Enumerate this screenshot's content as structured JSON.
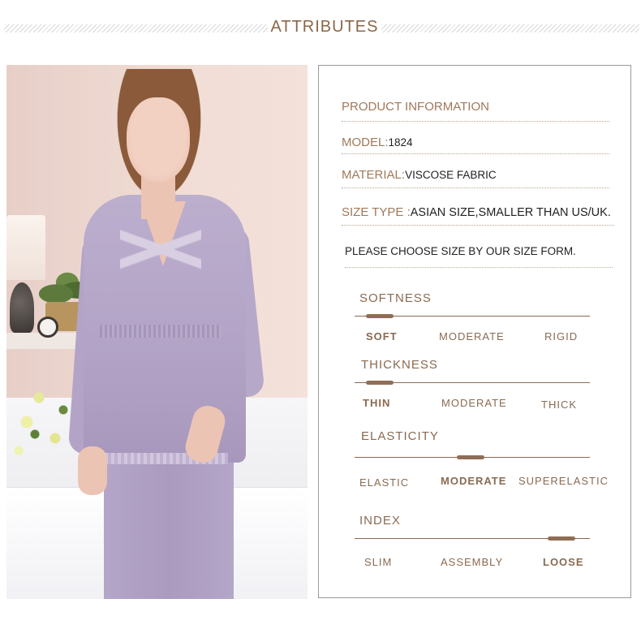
{
  "header": {
    "title": "ATTRIBUTES"
  },
  "info": {
    "heading": "PRODUCT INFORMATION",
    "model_label": "MODEL:",
    "model_value": "1824",
    "material_label": "MATERIAL:",
    "material_value": "VISCOSE FABRIC",
    "size_label": "SIZE TYPE :",
    "size_value": "ASIAN SIZE,SMALLER THAN US/UK.",
    "note": "PLEASE CHOOSE SIZE BY OUR SIZE FORM."
  },
  "scales": [
    {
      "title": "SOFTNESS",
      "options": [
        "SOFT",
        "MODERATE",
        "RIGID"
      ],
      "selected": "SOFT",
      "level": 0.0
    },
    {
      "title": "THICKNESS",
      "options": [
        "THIN",
        "MODERATE",
        "THICK"
      ],
      "selected": "THIN",
      "level": 0.0
    },
    {
      "title": "ELASTICITY",
      "options": [
        "ELASTIC",
        "MODERATE",
        "SUPERELASTIC"
      ],
      "selected": "MODERATE",
      "level": 0.5
    },
    {
      "title": "INDEX",
      "options": [
        "SLIM",
        "ASSEMBLY",
        "LOOSE"
      ],
      "selected": "LOOSE",
      "level": 1.0
    }
  ],
  "colors": {
    "accent": "#8a6a52",
    "label": "#a0785a",
    "text": "#222222",
    "border": "#9a9a9a"
  }
}
